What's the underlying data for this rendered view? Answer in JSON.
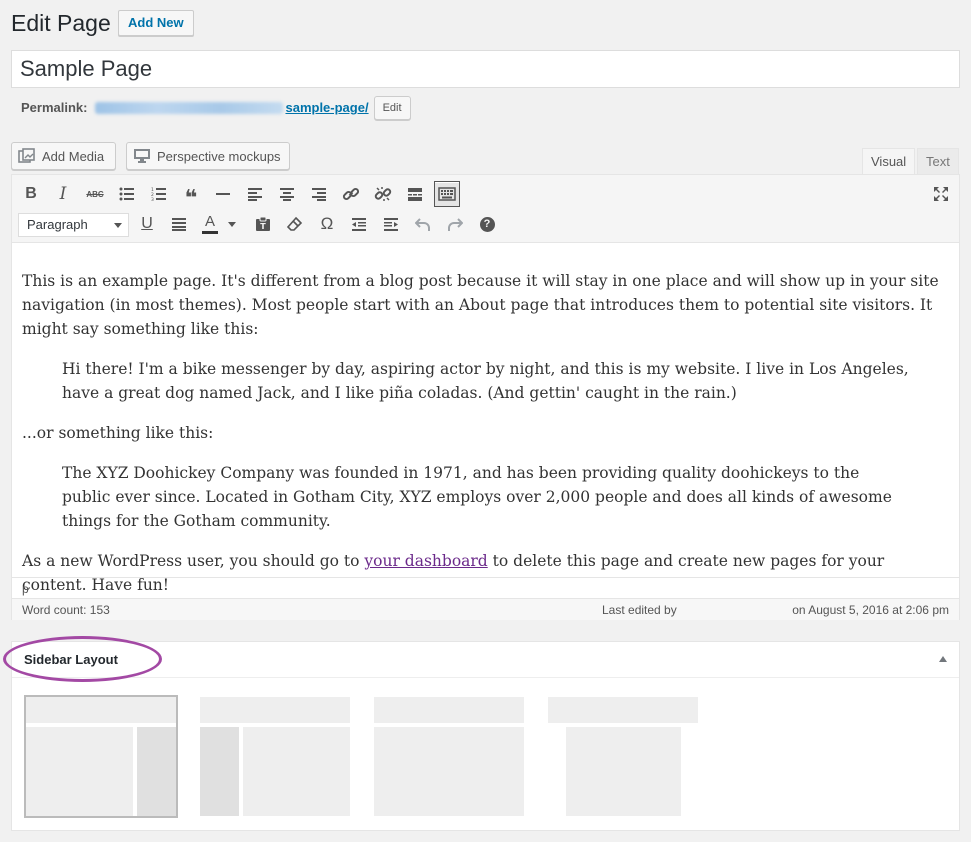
{
  "header": {
    "title": "Edit Page",
    "add_new_label": "Add New"
  },
  "title_field": {
    "value": "Sample Page"
  },
  "permalink": {
    "label": "Permalink:",
    "slug": "sample-page/",
    "edit_label": "Edit"
  },
  "media_buttons": {
    "add_media": "Add Media",
    "perspective": "Perspective mockups"
  },
  "editor_tabs": {
    "visual": "Visual",
    "text": "Text",
    "active": "Visual"
  },
  "toolbar": {
    "format_value": "Paragraph",
    "row1_icons": [
      "bold-icon",
      "italic-icon",
      "strikethrough-icon",
      "bulleted-list-icon",
      "numbered-list-icon",
      "blockquote-icon",
      "horizontal-line-icon",
      "align-left-icon",
      "align-center-icon",
      "align-right-icon",
      "insert-link-icon",
      "remove-link-icon",
      "read-more-icon",
      "toolbar-toggle-icon"
    ],
    "row2_icons": [
      "underline-icon",
      "justify-icon",
      "text-color-icon",
      "paste-as-text-icon",
      "clear-formatting-icon",
      "special-character-icon",
      "outdent-icon",
      "indent-icon",
      "undo-icon",
      "redo-icon",
      "help-icon"
    ],
    "labels": {
      "bold": "B",
      "italic": "I",
      "underline": "U",
      "text_color": "A",
      "omega": "Ω",
      "strike": "ABC",
      "quote": "❝",
      "help": "?"
    }
  },
  "content": {
    "p1": "This is an example page. It's different from a blog post because it will stay in one place and will show up in your site navigation (in most themes). Most people start with an About page that introduces them to potential site visitors. It might say something like this:",
    "quote1": "Hi there! I'm a bike messenger by day, aspiring actor by night, and this is my website. I live in Los Angeles, have a great dog named Jack, and I like piña coladas. (And gettin' caught in the rain.)",
    "p2": "...or something like this:",
    "quote2": "The XYZ Doohickey Company was founded in 1971, and has been providing quality doohickeys to the public ever since. Located in Gotham City, XYZ employs over 2,000 people and does all kinds of awesome things for the Gotham community.",
    "p3_before": "As a new WordPress user, you should go to ",
    "p3_link": "your dashboard",
    "p3_after": " to delete this page and create new pages for your content. Have fun!"
  },
  "status": {
    "path": "p",
    "word_count": "Word count: 153",
    "last_edited": "Last edited by",
    "edited_date": "on August 5, 2016 at 2:06 pm"
  },
  "sidebar_layout": {
    "title": "Sidebar Layout",
    "selected": "layout-right-sidebar"
  },
  "colors": {
    "accent": "#0073aa",
    "highlight": "#a349a4",
    "link_visited": "#6b2a8a"
  }
}
